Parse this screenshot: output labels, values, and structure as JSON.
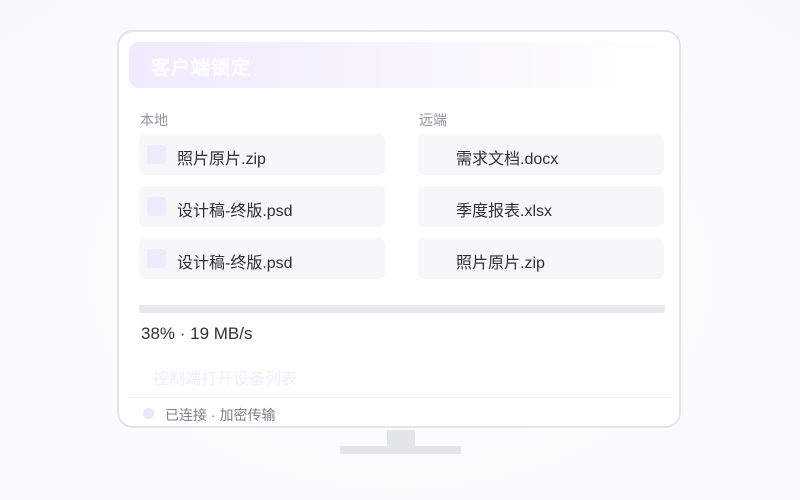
{
  "window": {
    "title": "客户端锁定"
  },
  "local": {
    "label": "本地",
    "files": [
      {
        "name": "照片原片.zip"
      },
      {
        "name": "设计稿-终版.psd"
      },
      {
        "name": "设计稿-终版.psd"
      }
    ]
  },
  "remote": {
    "label": "远端",
    "files": [
      {
        "name": "需求文档.docx"
      },
      {
        "name": "季度报表.xlsx"
      },
      {
        "name": "照片原片.zip"
      }
    ]
  },
  "transfer": {
    "progress_percent": 38,
    "status_text": "38% · 19 MB/s"
  },
  "actions": {
    "open_device_list": "控制端打开设备列表"
  },
  "status": {
    "text": "已连接 · 加密传输"
  },
  "colors": {
    "accent_light": "#efeafd",
    "track": "#e6e9ed",
    "text_primary": "#2d3036",
    "text_secondary": "#8d93a0"
  }
}
